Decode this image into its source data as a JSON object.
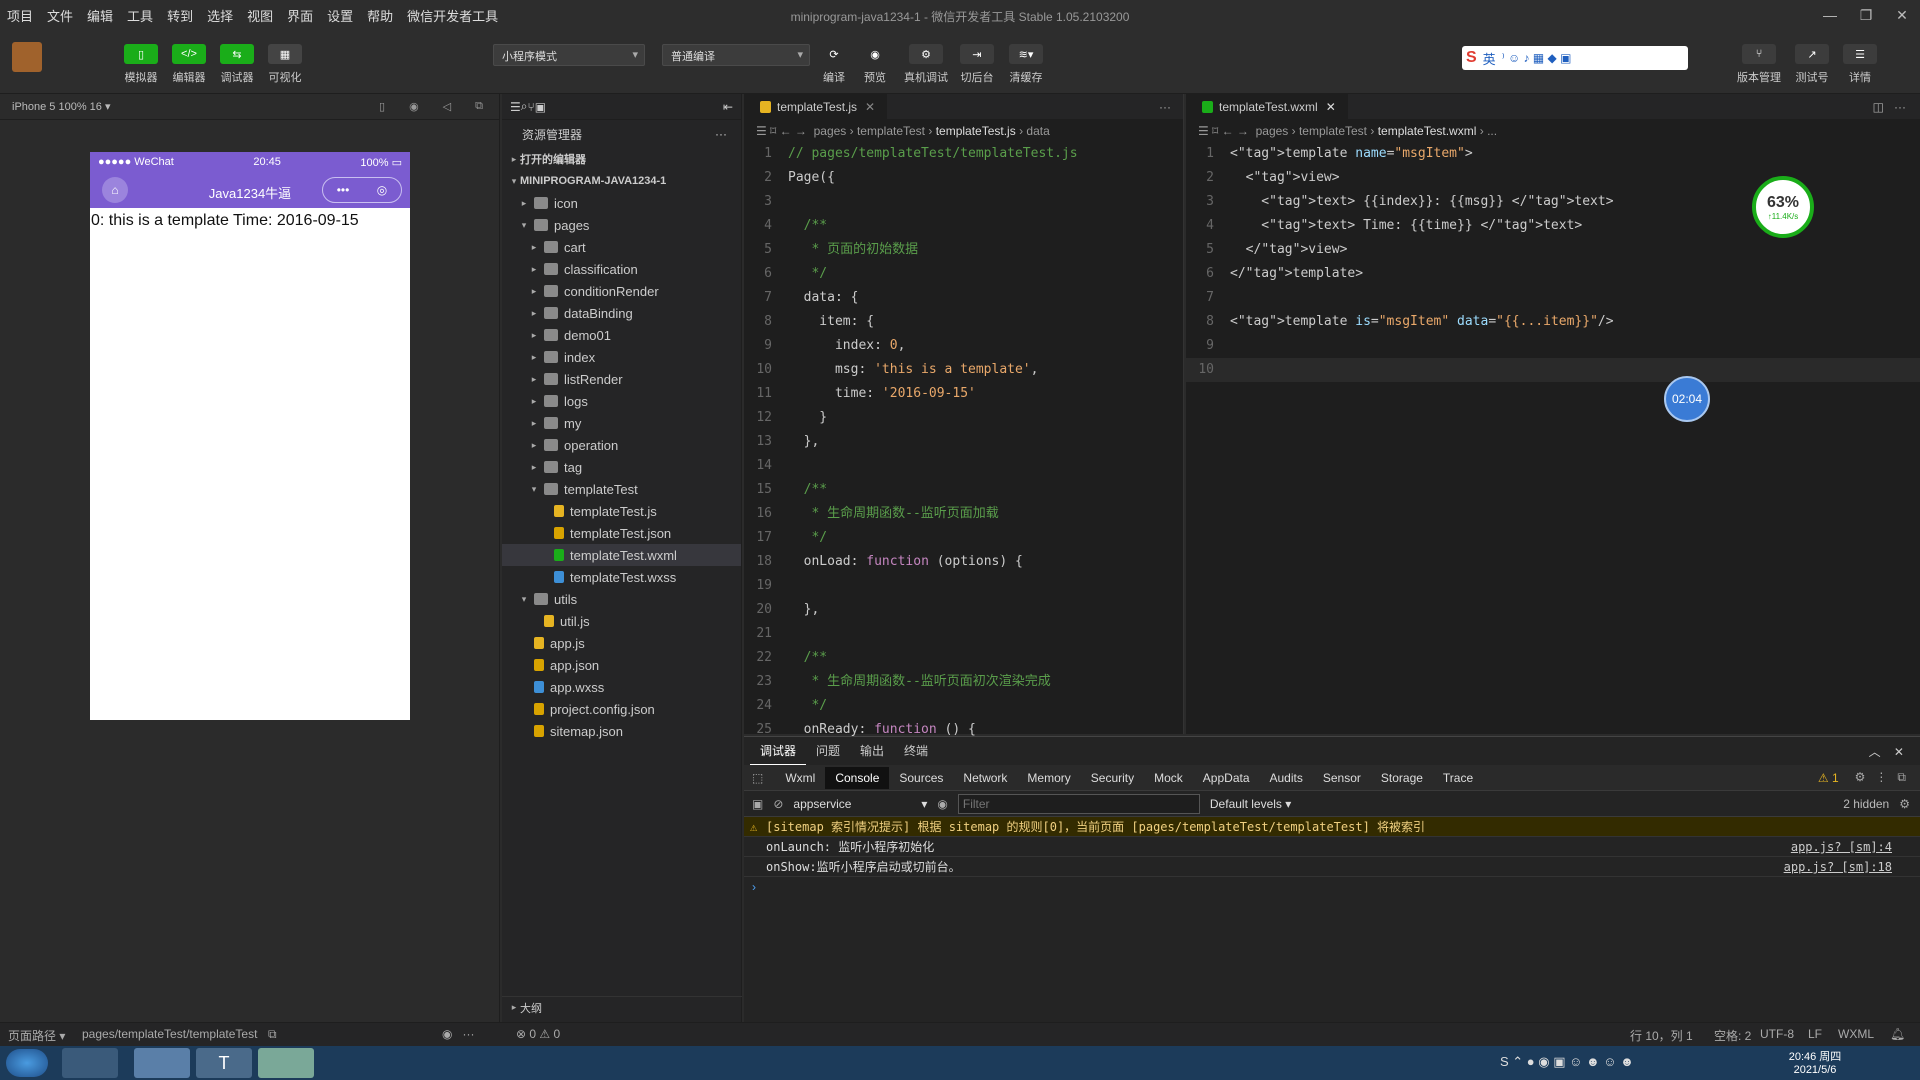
{
  "menu": [
    "项目",
    "文件",
    "编辑",
    "工具",
    "转到",
    "选择",
    "视图",
    "界面",
    "设置",
    "帮助",
    "微信开发者工具"
  ],
  "window_title": "miniprogram-java1234-1 - 微信开发者工具 Stable 1.05.2103200",
  "toolbar": {
    "left_buttons": [
      "模拟器",
      "编辑器",
      "调试器",
      "可视化"
    ],
    "mode_select": "小程序模式",
    "compile_select": "普通编译",
    "mid_buttons": [
      "编译",
      "预览",
      "真机调试",
      "切后台",
      "清缓存"
    ],
    "right_buttons": [
      "版本管理",
      "测试号",
      "详情"
    ],
    "ime_label": "英"
  },
  "simulator": {
    "device": "iPhone 5 100% 16 ▾",
    "status_carrier": "●●●●● WeChat",
    "status_time": "20:45",
    "status_battery": "100%",
    "nav_title": "Java1234牛逼",
    "content": "0: this is a template Time: 2016-09-15"
  },
  "explorer": {
    "title": "资源管理器",
    "open_editors": "打开的编辑器",
    "project": "MINIPROGRAM-JAVA1234-1",
    "tree": [
      {
        "name": "icon",
        "depth": 1,
        "type": "folder-c"
      },
      {
        "name": "pages",
        "depth": 1,
        "type": "folder-o"
      },
      {
        "name": "cart",
        "depth": 2,
        "type": "folder-c"
      },
      {
        "name": "classification",
        "depth": 2,
        "type": "folder-c"
      },
      {
        "name": "conditionRender",
        "depth": 2,
        "type": "folder-c"
      },
      {
        "name": "dataBinding",
        "depth": 2,
        "type": "folder-c"
      },
      {
        "name": "demo01",
        "depth": 2,
        "type": "folder-c"
      },
      {
        "name": "index",
        "depth": 2,
        "type": "folder-c"
      },
      {
        "name": "listRender",
        "depth": 2,
        "type": "folder-c"
      },
      {
        "name": "logs",
        "depth": 2,
        "type": "folder-c"
      },
      {
        "name": "my",
        "depth": 2,
        "type": "folder-c"
      },
      {
        "name": "operation",
        "depth": 2,
        "type": "folder-c"
      },
      {
        "name": "tag",
        "depth": 2,
        "type": "folder-c"
      },
      {
        "name": "templateTest",
        "depth": 2,
        "type": "folder-o"
      },
      {
        "name": "templateTest.js",
        "depth": 3,
        "type": "js"
      },
      {
        "name": "templateTest.json",
        "depth": 3,
        "type": "json"
      },
      {
        "name": "templateTest.wxml",
        "depth": 3,
        "type": "wxml",
        "active": true
      },
      {
        "name": "templateTest.wxss",
        "depth": 3,
        "type": "wxss"
      },
      {
        "name": "utils",
        "depth": 1,
        "type": "folder-o"
      },
      {
        "name": "util.js",
        "depth": 2,
        "type": "js"
      },
      {
        "name": "app.js",
        "depth": 1,
        "type": "js"
      },
      {
        "name": "app.json",
        "depth": 1,
        "type": "json"
      },
      {
        "name": "app.wxss",
        "depth": 1,
        "type": "wxss"
      },
      {
        "name": "project.config.json",
        "depth": 1,
        "type": "json"
      },
      {
        "name": "sitemap.json",
        "depth": 1,
        "type": "json"
      }
    ],
    "outline": "大纲"
  },
  "editor_js": {
    "tab": "templateTest.js",
    "breadcrumb": [
      "pages",
      "templateTest",
      "templateTest.js",
      "data"
    ],
    "lines": [
      "// pages/templateTest/templateTest.js",
      "Page({",
      "",
      "  /**",
      "   * 页面的初始数据",
      "   */",
      "  data: {",
      "    item: {",
      "      index: 0,",
      "      msg: 'this is a template',",
      "      time: '2016-09-15'",
      "    }",
      "  },",
      "",
      "  /**",
      "   * 生命周期函数--监听页面加载",
      "   */",
      "  onLoad: function (options) {",
      "",
      "  },",
      "",
      "  /**",
      "   * 生命周期函数--监听页面初次渲染完成",
      "   */",
      "  onReady: function () {"
    ]
  },
  "editor_wxml": {
    "tab": "templateTest.wxml",
    "breadcrumb": [
      "pages",
      "templateTest",
      "templateTest.wxml",
      "..."
    ],
    "lines": [
      "<template name=\"msgItem\">",
      "  <view>",
      "    <text> {{index}}: {{msg}} </text>",
      "    <text> Time: {{time}} </text>",
      "  </view>",
      "</template>",
      "",
      "<template is=\"msgItem\" data=\"{{...item}}\"/>",
      "",
      ""
    ],
    "cpu_percent": "63%",
    "cpu_speed": "↑11.4K/s",
    "timer": "02:04"
  },
  "devtools": {
    "tabs": [
      "调试器",
      "问题",
      "输出",
      "终端"
    ],
    "subtabs": [
      "Wxml",
      "Console",
      "Sources",
      "Network",
      "Memory",
      "Security",
      "Mock",
      "AppData",
      "Audits",
      "Sensor",
      "Storage",
      "Trace"
    ],
    "active_subtab": "Console",
    "warn_count": "1",
    "context": "appservice",
    "filter_placeholder": "Filter",
    "levels": "Default levels",
    "hidden": "2 hidden",
    "messages": [
      {
        "text": "[sitemap 索引情况提示] 根据 sitemap 的规则[0]，当前页面 [pages/templateTest/templateTest] 将被索引",
        "level": "warn",
        "src": ""
      },
      {
        "text": "onLaunch: 监听小程序初始化",
        "level": "log",
        "src": "app.js? [sm]:4"
      },
      {
        "text": "onShow:监听小程序启动或切前台。",
        "level": "log",
        "src": "app.js? [sm]:18"
      }
    ]
  },
  "statusbar": {
    "page_path_label": "页面路径",
    "page_path": "pages/templateTest/templateTest",
    "errors": "⊗ 0 ⚠ 0",
    "position": "行 10，列 1",
    "spaces": "空格: 2",
    "encoding": "UTF-8",
    "eol": "LF",
    "lang": "WXML"
  },
  "taskbar": {
    "time": "20:46 周四",
    "date": "2021/5/6"
  }
}
